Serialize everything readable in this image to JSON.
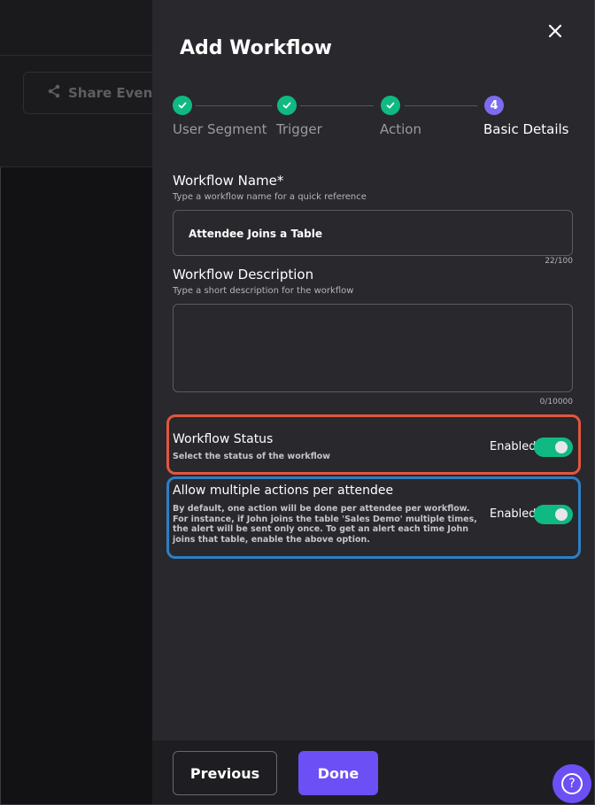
{
  "background": {
    "share_button": {
      "label": "Share Event",
      "icon": "share-icon"
    }
  },
  "modal": {
    "title": "Add Workflow",
    "close_icon": "close-icon",
    "steps": [
      {
        "label": "User Segment",
        "state": "done"
      },
      {
        "label": "Trigger",
        "state": "done"
      },
      {
        "label": "Action",
        "state": "done"
      },
      {
        "label": "Basic Details",
        "state": "active",
        "number": "4"
      }
    ],
    "workflow_name": {
      "label": "Workflow Name*",
      "helper": "Type a workflow name for a quick reference",
      "value": "Attendee Joins a Table",
      "counter": "22/100"
    },
    "workflow_description": {
      "label": "Workflow Description",
      "helper": "Type a short description for the workflow",
      "value": "",
      "counter": "0/10000"
    },
    "workflow_status": {
      "label": "Workflow Status",
      "helper": "Select the status of the workflow",
      "toggle_label": "Enabled",
      "enabled": true
    },
    "multiple_actions": {
      "label": "Allow multiple actions per attendee",
      "description": "By default, one action will be done per attendee per workflow. For instance, if John joins the table 'Sales Demo' multiple times, the alert will be sent only once. To get an alert each time John joins that table, enable the above option.",
      "toggle_label": "Enabled",
      "enabled": true
    },
    "footer": {
      "previous_label": "Previous",
      "done_label": "Done"
    },
    "help_button": {
      "label": "?"
    }
  },
  "colors": {
    "accent": "#6c4ff5",
    "success": "#10b981",
    "highlight_red": "#e2563f",
    "highlight_blue": "#2f7fc4"
  }
}
